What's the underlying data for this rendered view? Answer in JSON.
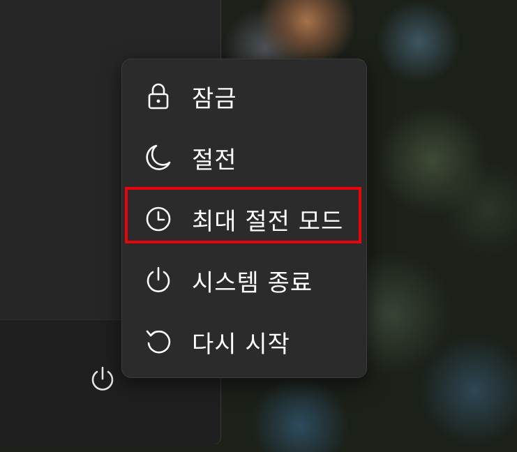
{
  "power_menu": {
    "items": [
      {
        "label": "잠금",
        "icon": "lock-icon"
      },
      {
        "label": "절전",
        "icon": "moon-icon"
      },
      {
        "label": "최대 절전 모드",
        "icon": "clock-icon"
      },
      {
        "label": "시스템 종료",
        "icon": "power-icon"
      },
      {
        "label": "다시 시작",
        "icon": "restart-icon"
      }
    ],
    "highlighted_item": "최대 절전 모드",
    "highlight_color": "#e8060c"
  },
  "start_panel": {
    "footer_button_icon": "power-icon"
  }
}
